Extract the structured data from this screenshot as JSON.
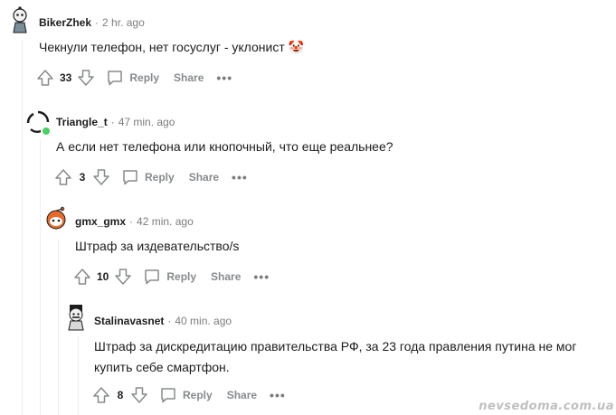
{
  "comments": [
    {
      "author": "BikerZhek",
      "dot": "·",
      "time": "2 hr. ago",
      "body": "Чекнули телефон, нет госуслуг - уклонист 🤡",
      "score": "33",
      "reply_label": "Reply",
      "share_label": "Share",
      "more_label": "•••"
    },
    {
      "author": "Triangle_t",
      "dot": "·",
      "time": "47 min. ago",
      "body": "А если нет телефона или кнопочный, что еще реальнее?",
      "score": "3",
      "reply_label": "Reply",
      "share_label": "Share",
      "more_label": "•••"
    },
    {
      "author": "gmx_gmx",
      "dot": "·",
      "time": "42 min. ago",
      "body": "Штраф за издевательство/s",
      "score": "10",
      "reply_label": "Reply",
      "share_label": "Share",
      "more_label": "•••"
    },
    {
      "author": "Stalinavasnet",
      "dot": "·",
      "time": "40 min. ago",
      "body": "Штраф за дискредитацию правительства РФ, за 23 года правления путина не мог купить себе смартфон.",
      "score": "8",
      "reply_label": "Reply",
      "share_label": "Share",
      "more_label": "•••"
    }
  ],
  "watermark": "nevsedoma.com.ua",
  "icons": {
    "upvote": "arrow-up-outline",
    "downvote": "arrow-down-outline",
    "reply": "speech-bubble-outline",
    "online": "green-dot"
  },
  "colors": {
    "text": "#1c1c1c",
    "muted": "#7c7c7c",
    "action": "#878a8c",
    "thread": "#edeff1",
    "online": "#46d160"
  }
}
